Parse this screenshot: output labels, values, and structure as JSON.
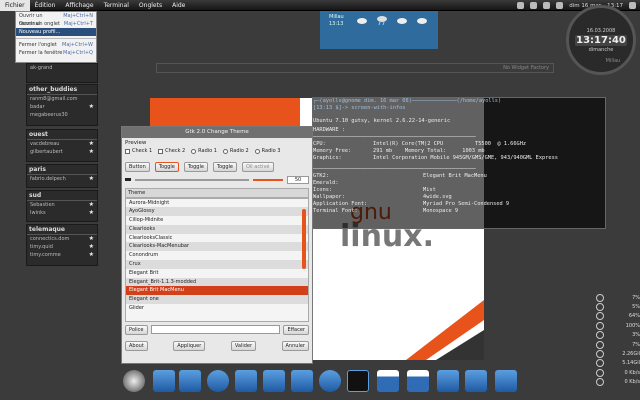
{
  "menubar": {
    "items": [
      "Fichier",
      "Édition",
      "Affichage",
      "Terminal",
      "Onglets",
      "Aide"
    ],
    "active": "Fichier"
  },
  "tray": {
    "datetime": "dim 16 mar\n13:17",
    "date": "dim 16 mar",
    "time": "13:17"
  },
  "file_menu": {
    "items": [
      {
        "label": "Ouvrir un terminal",
        "shortcut": "Maj+Ctrl+N"
      },
      {
        "label": "Ouvrir un onglet",
        "shortcut": "Maj+Ctrl+T"
      },
      {
        "label": "Nouveau profil...",
        "shortcut": "",
        "highlighted": true
      },
      {
        "label": "Fermer l'onglet",
        "shortcut": "Maj+Ctrl+W"
      },
      {
        "label": "Fermer la fenêtre",
        "shortcut": "Maj+Ctrl+Q"
      }
    ]
  },
  "sidebar_groups": [
    {
      "title": "",
      "items": [
        {
          "label": "",
          "star": false
        },
        {
          "label": "ak-grand",
          "star": false
        }
      ]
    },
    {
      "title": "other_buddies",
      "items": [
        {
          "label": "ranm8@gmail.com",
          "star": false
        },
        {
          "label": "badar",
          "star": true
        },
        {
          "label": "megabeerus30",
          "star": false
        }
      ]
    },
    {
      "title": "ouest",
      "items": [
        {
          "label": "vacdebreau",
          "star": true
        },
        {
          "label": "gilbertaubert",
          "star": true
        }
      ]
    },
    {
      "title": "paris",
      "items": [
        {
          "label": "fabrio.delpech",
          "star": true
        }
      ]
    },
    {
      "title": "sud",
      "items": [
        {
          "label": "Sebastien",
          "star": true
        },
        {
          "label": "Iwinks",
          "star": true
        }
      ]
    },
    {
      "title": "telemaque",
      "items": [
        {
          "label": "connectics.dom",
          "star": true
        },
        {
          "label": "timy.quid",
          "star": true
        },
        {
          "label": "timy.comme",
          "star": true
        }
      ]
    }
  ],
  "weather": {
    "city": "Millau",
    "time": "13:13"
  },
  "clock": {
    "date": "16.03.2008",
    "time": "13:17:40",
    "weekday": "dimanche",
    "city": "Millau"
  },
  "widget_bar": {
    "label": "No Widget Factory"
  },
  "terminal": {
    "prompt_user": "ayolls@gnome dim. 16 mar 08",
    "prompt_path": "/home/ayolls",
    "command": "[13:13 $]-> screen-with-infos",
    "distro": "Ubuntu 7.10 gutsy, kernel 2.6.22-14-generic",
    "hardware_label": "HARDWARE :",
    "hardware": [
      {
        "k": "CPU:",
        "v": "Intel(R) Core(TM)2 CPU          T5500  @ 1.66GHz"
      },
      {
        "k": "Memory Free:",
        "v": "291 mb    Memory Total:     1003 mb"
      },
      {
        "k": "Graphics:",
        "v": "Intel Corporation Mobile 945GM/GMS/GME, 943/940GML Express"
      }
    ],
    "software": [
      {
        "k": "GTK2:",
        "v": "Elegant Brit MacMenu"
      },
      {
        "k": "Emerald:",
        "v": ""
      },
      {
        "k": "Icons:",
        "v": "Mist"
      },
      {
        "k": "Wallpaper:",
        "v": "4wide.svg"
      },
      {
        "k": "Application Font:",
        "v": "Myriad Pro Semi-Condensed 9"
      },
      {
        "k": "Terminal Font:",
        "v": "Monospace 9"
      }
    ]
  },
  "wallpaper_text": {
    "line1": "gnu",
    "line2": "linux."
  },
  "dialog": {
    "title": "Gtk 2.0 Change Theme",
    "preview_label": "Preview",
    "check1": "Check 1",
    "check2": "Check 2",
    "radio1": "Radio 1",
    "radio2": "Radio 2",
    "radio3": "Radio 3",
    "btn_button": "Button",
    "btn_toggle1": "Toggle",
    "btn_toggle2": "Toggle",
    "btn_toggle3": "Toggle",
    "btn_disabled": "Oil activé",
    "spin_value": "50",
    "theme_header": "Theme",
    "themes": [
      "Aurora-Midnight",
      "AyoGlossy",
      "Cillop-Midnite",
      "Clearlooks",
      "ClearlooksClassic",
      "Clearlooks-MacMenubar",
      "Conondrum",
      "Crux",
      "Elegant Brit",
      "Elegant_Brit-1.1.3-modded",
      "Elegant Brit MacMenu",
      "Elegant one",
      "Glider"
    ],
    "selected_theme": "Elegant Brit MacMenu",
    "police_label": "Police",
    "effacer_label": "Effacer",
    "about": "About",
    "apply": "Appliquer",
    "validate": "Valider",
    "cancel": "Annuler"
  },
  "stats": [
    {
      "value": "7%"
    },
    {
      "value": "5%"
    },
    {
      "value": "64%"
    },
    {
      "value": "100%"
    },
    {
      "value": "3%"
    },
    {
      "value": "7%"
    },
    {
      "value": "2.26Gil"
    },
    {
      "value": "5.14Gil"
    },
    {
      "value": "0 Kb/s"
    },
    {
      "value": "0 Kb/s"
    }
  ],
  "dock": {
    "icons": [
      "magnifier-icon",
      "home-icon",
      "mail-icon",
      "smiley-icon",
      "headphones-icon",
      "writer-icon",
      "image-icon",
      "settings-icon",
      "terminal-icon",
      "calendar-icon",
      "calendar2-icon",
      "folder-icon",
      "download-icon",
      "trash-icon"
    ]
  }
}
